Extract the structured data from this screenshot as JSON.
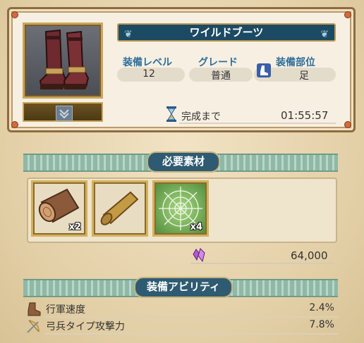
{
  "item": {
    "name": "ワイルドブーツ",
    "icon": "leather-boots-icon",
    "rarity_icon": "chevron-slot-icon"
  },
  "stats": {
    "level_label": "装備レベル",
    "level_value": "12",
    "grade_label": "グレード",
    "grade_value": "普通",
    "slot_label": "装備部位",
    "slot_value": "足",
    "slot_icon": "boot-slot-icon"
  },
  "timer": {
    "label": "完成まで",
    "value": "01:55:57",
    "icon": "hourglass-icon"
  },
  "materials": {
    "header": "必要素材",
    "items": [
      {
        "icon": "log-icon",
        "count": "x2"
      },
      {
        "icon": "parchment-scroll-icon",
        "count": ""
      },
      {
        "icon": "spider-web-icon",
        "count": "x4"
      }
    ],
    "cost_icon": "purple-crystal-icon",
    "cost_value": "64,000"
  },
  "abilities": {
    "header": "装備アビリティ",
    "rows": [
      {
        "icon": "boot-icon",
        "label": "行軍速度",
        "value": "2.4%"
      },
      {
        "icon": "bow-arrow-icon",
        "label": "弓兵タイプ攻撃力",
        "value": "7.8%"
      }
    ]
  },
  "colors": {
    "banner": "#1d4a63",
    "label_blue": "#2e6e9a",
    "panel_border": "#8f6b3f"
  }
}
